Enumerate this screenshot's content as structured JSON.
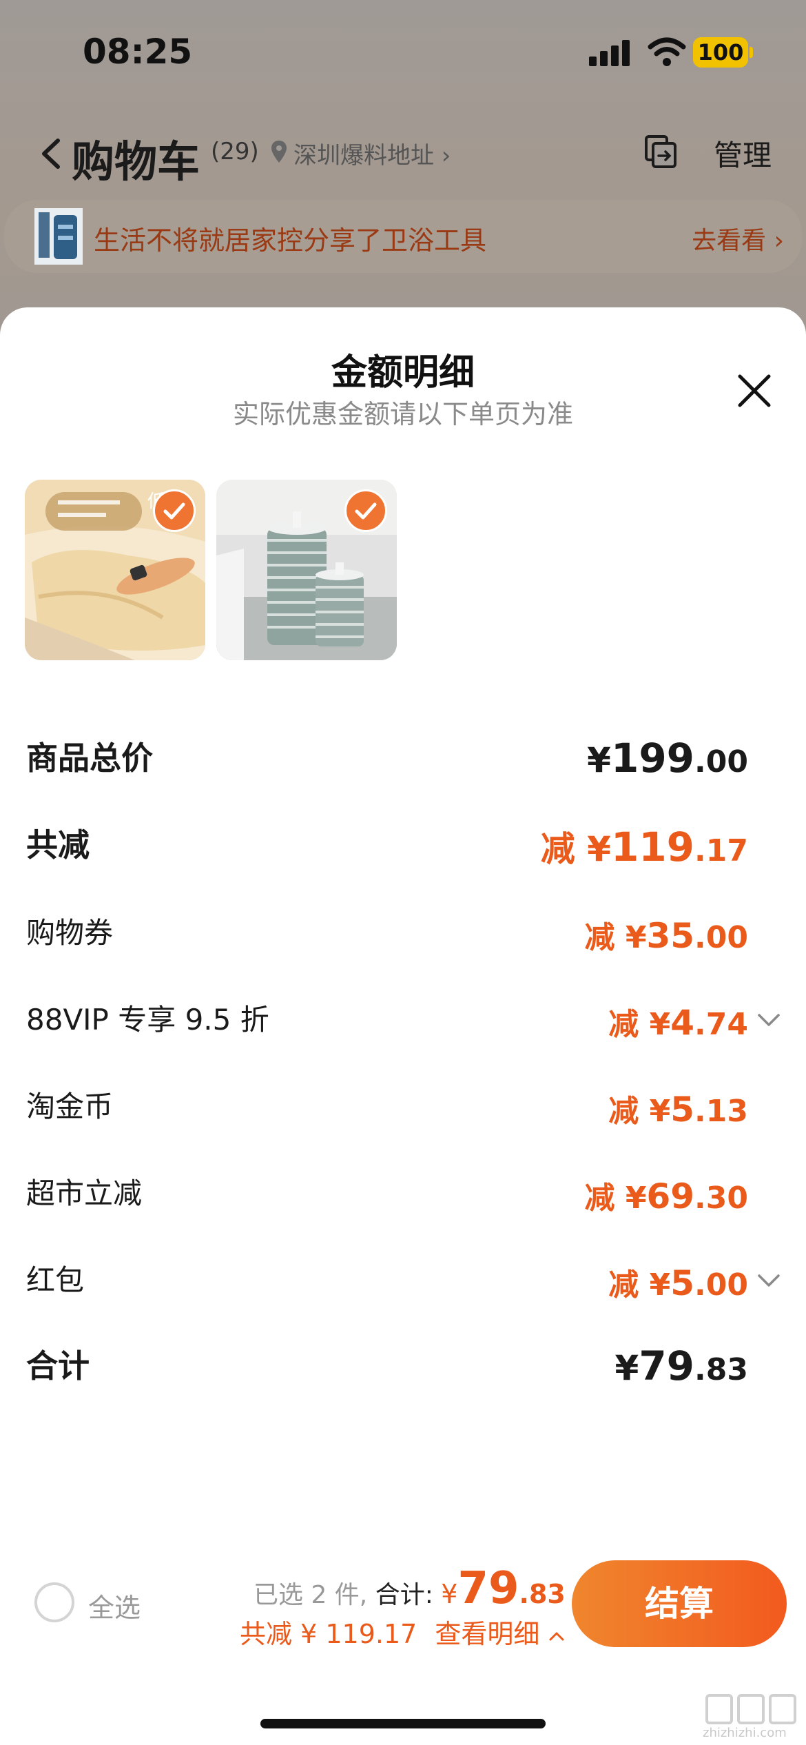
{
  "status_bar": {
    "time": "08:25",
    "battery": "100"
  },
  "header": {
    "title": "购物车",
    "count": "(29)",
    "address": "深圳爆料地址 ›",
    "manage": "管理"
  },
  "banner": {
    "text": "生活不将就居家控分享了卫浴工具",
    "link": "去看看 ›"
  },
  "sheet": {
    "title": "金额明细",
    "subtitle": "实际优惠金额请以下单页为准",
    "products": [
      {
        "name": "pillow",
        "image_label": "低"
      },
      {
        "name": "mop-refills"
      }
    ],
    "rows": [
      {
        "label": "商品总价",
        "prefix": "",
        "currency": "¥",
        "int": "199",
        "dec": ".00"
      },
      {
        "label": "共减",
        "prefix": "减 ",
        "currency": "¥",
        "int": "119",
        "dec": ".17"
      },
      {
        "label": "购物券",
        "prefix": "减 ",
        "currency": "¥",
        "int": "35",
        "dec": ".00"
      },
      {
        "label": "88VIP 专享 9.5 折",
        "prefix": "减 ",
        "currency": "¥",
        "int": "4",
        "dec": ".74"
      },
      {
        "label": "淘金币",
        "prefix": "减 ",
        "currency": "¥",
        "int": "5",
        "dec": ".13"
      },
      {
        "label": "超市立减",
        "prefix": "减 ",
        "currency": "¥",
        "int": "69",
        "dec": ".30"
      },
      {
        "label": "红包",
        "prefix": "减 ",
        "currency": "¥",
        "int": "5",
        "dec": ".00"
      },
      {
        "label": "合计",
        "prefix": "",
        "currency": "¥",
        "int": "79",
        "dec": ".83"
      }
    ]
  },
  "bottom_bar": {
    "select_all": "全选",
    "selected_text": "已选 2 件,",
    "total_label": "合计:",
    "currency": "¥",
    "total_int": "79",
    "total_dec": ".83",
    "discount_text": "共减 ¥ 119.17",
    "detail_link": "查看明细",
    "checkout": "结算"
  },
  "watermark": "zhizhizhi.com",
  "colors": {
    "accent": "#ea5a1b",
    "checkout_start": "#f0862e",
    "checkout_end": "#f25a1e"
  }
}
